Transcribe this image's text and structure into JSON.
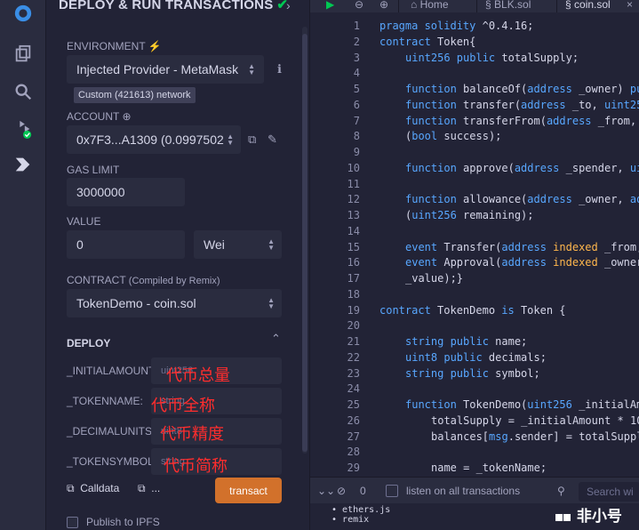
{
  "colors": {
    "accent": "#d2712b",
    "success": "#00c853",
    "keyword": "#58a7ff",
    "annotation": "#ff2d2d"
  },
  "rail_icons": [
    "remix-logo-icon",
    "file-explorer-icon",
    "search-icon",
    "solidity-compiler-icon",
    "deploy-run-icon"
  ],
  "panel": {
    "title": "DEPLOY & RUN TRANSACTIONS",
    "environment_label": "ENVIRONMENT",
    "environment_value": "Injected Provider - MetaMask",
    "network_badge": "Custom (421613) network",
    "account_label": "ACCOUNT",
    "account_value": "0x7F3...A1309 (0.0997502",
    "gas_limit_label": "GAS LIMIT",
    "gas_limit_value": "3000000",
    "value_label": "VALUE",
    "value_amount": "0",
    "value_unit": "Wei",
    "contract_label": "CONTRACT",
    "contract_sub": "(Compiled by Remix)",
    "contract_value": "TokenDemo - coin.sol",
    "deploy_label": "DEPLOY",
    "params": [
      {
        "name": "_INITIALAMOUNT:",
        "placeholder": "uint256",
        "annotation": "代币总量"
      },
      {
        "name": "_TOKENNAME:",
        "placeholder": "string",
        "annotation": "代币全称"
      },
      {
        "name": "_DECIMALUNITS:",
        "placeholder": "uint8",
        "annotation": "代币精度"
      },
      {
        "name": "_TOKENSYMBOL:",
        "placeholder": "string",
        "annotation": "代币简称"
      }
    ],
    "calldata_label": "Calldata",
    "more_label": "...",
    "transact_label": "transact",
    "publish_label": "Publish to IPFS"
  },
  "editor": {
    "tabs": [
      "Home",
      "BLK.sol",
      "coin.sol"
    ],
    "line_numbers": [
      "1",
      "2",
      "3",
      "4",
      "5",
      "6",
      "7",
      "8",
      "9",
      "10",
      "11",
      "12",
      "13",
      "14",
      "15",
      "16",
      "17",
      "18",
      "19",
      "20",
      "21",
      "22",
      "23",
      "24",
      "25",
      "26",
      "27",
      "28",
      "29"
    ],
    "terminal": {
      "count": "0",
      "listen_label": "listen on all transactions",
      "search_placeholder": "Search wi",
      "lines": [
        "ethers.js",
        "remix"
      ]
    }
  },
  "watermark": "非小号"
}
